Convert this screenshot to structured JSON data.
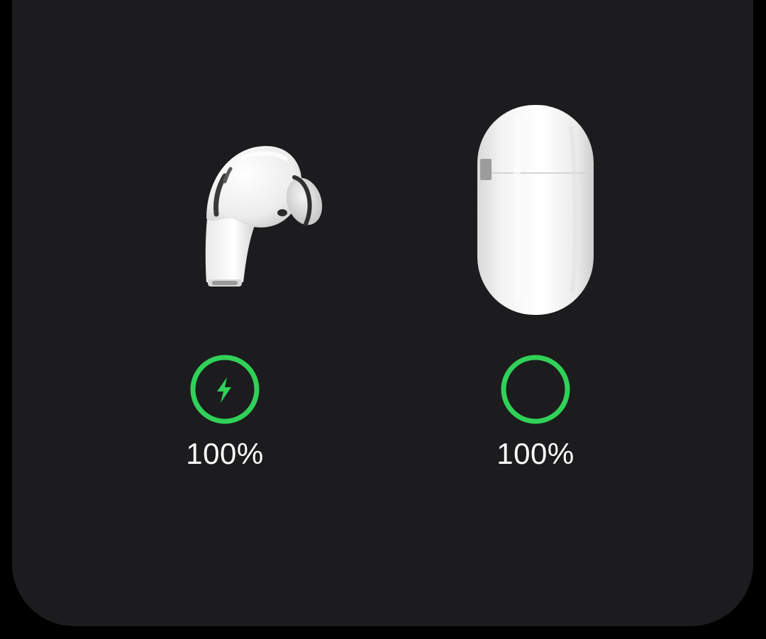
{
  "devices": [
    {
      "name": "earbud",
      "icon": "airpod-earbud-icon",
      "battery": {
        "percent_label": "100%",
        "level": 1.0,
        "charging": true,
        "charging_icon": "lightning-bolt-icon"
      }
    },
    {
      "name": "case",
      "icon": "airpods-case-icon",
      "battery": {
        "percent_label": "100%",
        "level": 1.0,
        "charging": false
      }
    }
  ],
  "colors": {
    "background": "#000000",
    "panel": "#1c1c1e",
    "battery_ring": "#30d158",
    "text": "#ffffff"
  }
}
